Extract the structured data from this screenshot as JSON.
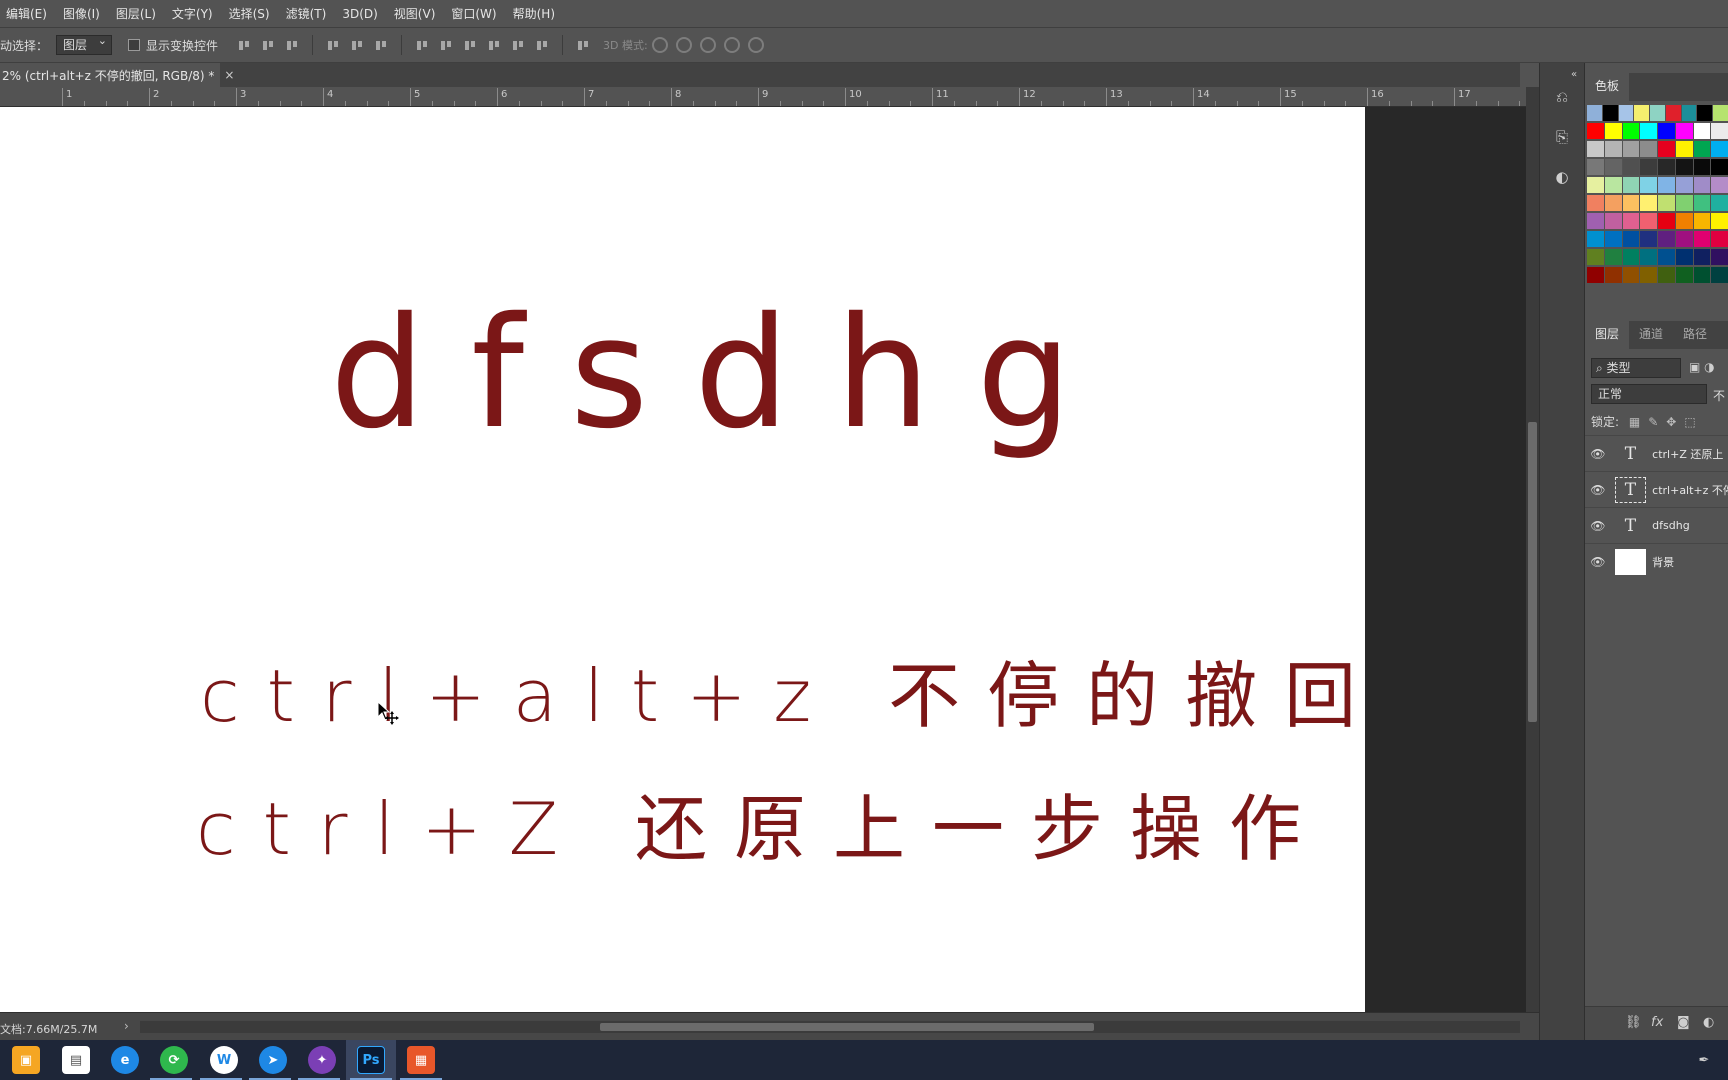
{
  "menu": [
    "编辑(E)",
    "图像(I)",
    "图层(L)",
    "文字(Y)",
    "选择(S)",
    "滤镜(T)",
    "3D(D)",
    "视图(V)",
    "窗口(W)",
    "帮助(H)"
  ],
  "options": {
    "auto_select_label": "动选择：",
    "auto_select_value": "图层",
    "show_transform_label": "显示变换控件",
    "mode_3d_label": "3D 模式:"
  },
  "document_tab": {
    "title": "2% (ctrl+alt+z 不停的撤回, RGB/8) *",
    "close": "×"
  },
  "ruler": [
    "1",
    "2",
    "3",
    "4",
    "5",
    "6",
    "7",
    "8",
    "9",
    "10",
    "11",
    "12",
    "13",
    "14",
    "15",
    "16",
    "17"
  ],
  "canvas": {
    "line1": "dfsdhg",
    "line2": "ctrl+alt+z 不停的撤回",
    "line3": "ctrl+Z  还原上一步操作",
    "text_color": "#7b1717"
  },
  "status": {
    "doc_size": "文档:7.66M/25.7M",
    "arrow": "›"
  },
  "swatches_panel": {
    "tab": "色板",
    "rows": [
      [
        "#8fb0d9",
        "#000000",
        "#a6c4e8",
        "#f5ef6e",
        "#8ed3c3",
        "#e0202b",
        "#1c8f9a",
        "#000000",
        "#b6e36f"
      ],
      [
        "#ff0000",
        "#ffff00",
        "#00ff00",
        "#00ffff",
        "#0000ff",
        "#ff00ff",
        "#ffffff",
        "#ebebeb"
      ],
      [
        "#c8c8c8",
        "#b4b4b4",
        "#a0a0a0",
        "#8c8c8c",
        "#e6001e",
        "#fff200",
        "#00a651",
        "#00aeef"
      ],
      [
        "#787878",
        "#646464",
        "#505050",
        "#3c3c3c",
        "#282828",
        "#141414",
        "#0a0a0a",
        "#000000"
      ],
      [
        "#e6f0a0",
        "#b9e6a0",
        "#8fd4b4",
        "#7fd2e6",
        "#80b4e6",
        "#96a0d7",
        "#a08cc8",
        "#b48cc8"
      ],
      [
        "#f08060",
        "#f4a060",
        "#fcc060",
        "#fff070",
        "#c0e070",
        "#80d070",
        "#40c080",
        "#20b0a0"
      ],
      [
        "#a060b0",
        "#c060a0",
        "#e06090",
        "#f06070",
        "#e60012",
        "#f08000",
        "#f8b500",
        "#fff000"
      ],
      [
        "#0090d0",
        "#0070c0",
        "#0050a0",
        "#203080",
        "#602080",
        "#a01080",
        "#e00070",
        "#e00040"
      ],
      [
        "#608020",
        "#208040",
        "#008060",
        "#007080",
        "#005090",
        "#003070",
        "#102060",
        "#301060"
      ],
      [
        "#900000",
        "#903000",
        "#905000",
        "#806000",
        "#406010",
        "#106020",
        "#005030",
        "#004040"
      ]
    ]
  },
  "layers_panel": {
    "tabs": [
      "图层",
      "通道",
      "路径"
    ],
    "filter": "类型",
    "blend_mode": "正常",
    "opacity_label": "不",
    "lock_label": "锁定:",
    "layers": [
      {
        "name": "ctrl+Z 还原上",
        "kind": "T",
        "selected": false
      },
      {
        "name": "ctrl+alt+z 不停",
        "kind": "T",
        "selected": true
      },
      {
        "name": "dfsdhg",
        "kind": "T",
        "selected": false
      },
      {
        "name": "背景",
        "kind": "bg",
        "selected": false
      }
    ]
  },
  "taskbar": {
    "apps": [
      "store",
      "file",
      "ie",
      "sync",
      "w",
      "feiyu",
      "ps-cs",
      "Ps",
      "slides"
    ],
    "ps_label": "Ps",
    "w_label": "W"
  }
}
